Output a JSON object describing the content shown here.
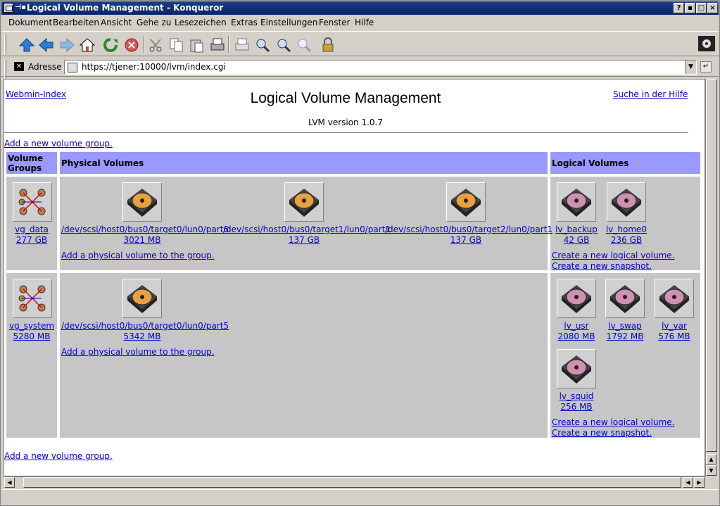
{
  "window": {
    "title": "Logical Volume Management - Konqueror"
  },
  "menu": [
    "Dokument",
    "Bearbeiten",
    "Ansicht",
    "Gehe zu",
    "Lesezeichen",
    "Extras",
    "Einstellungen",
    "Fenster",
    "Hilfe"
  ],
  "address": {
    "label": "Adresse",
    "url": "https://tjener:10000/lvm/index.cgi"
  },
  "page": {
    "webmin_index": "Webmin-Index",
    "help_link": "Suche in der Hilfe",
    "title": "Logical Volume Management",
    "version": "LVM version 1.0.7",
    "add_vg": "Add a new volume group.",
    "add_vg_bottom": "Add a new volume group.",
    "headers": {
      "vg": "Volume Groups",
      "pv": "Physical Volumes",
      "lv": "Logical Volumes"
    },
    "add_pv": "Add a physical volume to the group.",
    "create_lv": "Create a new logical volume.",
    "create_snapshot": "Create a new snapshot.",
    "groups": [
      {
        "name": "vg_data",
        "size": "277 GB",
        "pvs": [
          {
            "name": "/dev/scsi/host0/bus0/target0/lun0/part6",
            "size": "3021 MB"
          },
          {
            "name": "/dev/scsi/host0/bus0/target1/lun0/part1",
            "size": "137 GB"
          },
          {
            "name": "/dev/scsi/host0/bus0/target2/lun0/part1",
            "size": "137 GB"
          }
        ],
        "lvs": [
          {
            "name": "lv_backup",
            "size": "42 GB"
          },
          {
            "name": "lv_home0",
            "size": "236 GB"
          }
        ]
      },
      {
        "name": "vg_system",
        "size": "5280 MB",
        "pvs": [
          {
            "name": "/dev/scsi/host0/bus0/target0/lun0/part5",
            "size": "5342 MB"
          }
        ],
        "lvs": [
          {
            "name": "lv_usr",
            "size": "2080 MB"
          },
          {
            "name": "lv_swap",
            "size": "1792 MB"
          },
          {
            "name": "lv_var",
            "size": "576 MB"
          },
          {
            "name": "lv_squid",
            "size": "256 MB"
          }
        ]
      }
    ]
  },
  "icons": {
    "toolbar": [
      "up-arrow-icon",
      "back-arrow-icon",
      "forward-arrow-icon",
      "home-icon",
      "reload-icon",
      "stop-icon",
      "cut-icon",
      "copy-icon",
      "paste-icon",
      "print-icon",
      "print-frame-icon",
      "zoom-in-icon",
      "zoom-out-icon",
      "zoom-reset-icon",
      "lock-icon"
    ],
    "colors": {
      "title_bg": "#0a2466",
      "table_header": "#9999ff",
      "table_cell": "#c6c6c6",
      "link": "#0000cc"
    }
  }
}
